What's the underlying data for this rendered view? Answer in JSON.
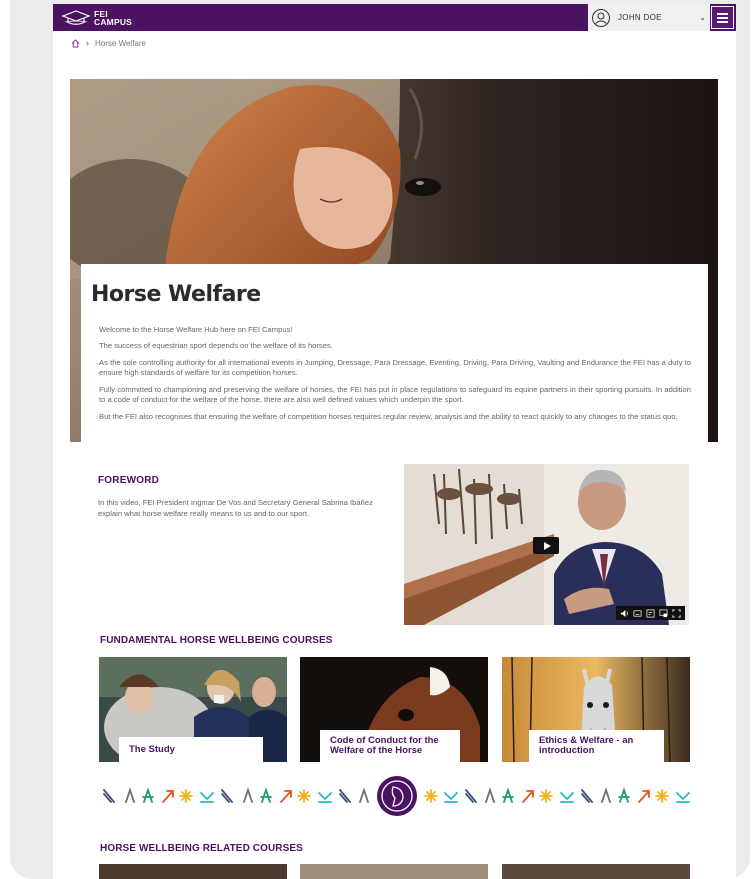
{
  "header": {
    "logo_line1": "FEI",
    "logo_line2": "CAMPUS",
    "user_name": "JOHN DOE"
  },
  "breadcrumb": {
    "current": "Horse Welfare"
  },
  "hero": {
    "title": "Horse Welfare",
    "paragraphs": [
      "Welcome to the Horse Welfare Hub here on FEI Campus!",
      "The success of equestrian sport depends on the welfare of its horses.",
      "As the sole controlling authority for all international events in Jumping, Dressage, Para Dressage, Eventing, Driving, Para Driving, Vaulting and Endurance the FEI has a duty to ensure high standards of welfare for its competition horses.",
      "Fully committed to championing and preserving the welfare of horses, the FEI has put in place regulations to safeguard its equine partners in their sporting pursuits. In addition to a code of conduct for the welfare of the horse, there are also well defined values which underpin the sport.",
      "But the FEI also recognises that ensuring the welfare of competition horses requires regular review, analysis and the ability to react quickly to any changes to the status quo."
    ]
  },
  "foreword": {
    "title": "FOREWORD",
    "text": "In this video, FEI President Ingmar De Vos and Secretary General Sabrina Ibáñez explain what horse welfare really means to us and to our sport."
  },
  "fundamental": {
    "title": "FUNDAMENTAL HORSE WELLBEING COURSES",
    "courses": [
      {
        "label": "The Study"
      },
      {
        "label": "Code of Conduct for the Welfare of the Horse"
      },
      {
        "label": "Ethics & Welfare - an introduction"
      }
    ]
  },
  "related": {
    "title": "HORSE WELLBEING RELATED COURSES"
  },
  "colors": {
    "brand_purple": "#4b1261",
    "pattern_navy": "#3d4f7c",
    "pattern_green": "#1f9a6e",
    "pattern_orange": "#e8521f",
    "pattern_yellow": "#f5b11a",
    "pattern_teal": "#29b6c4",
    "pattern_grey": "#6f6f6f"
  }
}
